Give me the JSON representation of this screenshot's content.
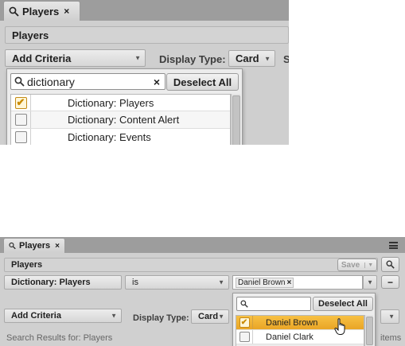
{
  "colors": {
    "accent": "#e9a526",
    "tab_strip": "#9d9d9d",
    "panel_bar": "#d3d3d3",
    "popup_bg": "#ececec"
  },
  "top": {
    "tab": {
      "icon": "search-icon",
      "label": "Players",
      "close": "×"
    },
    "panel_title": "Players",
    "add_criteria": "Add Criteria",
    "display_type_label": "Display Type:",
    "display_type_value": "Card",
    "truncated_label": "S",
    "popup": {
      "search_value": "dictionary",
      "clear": "×",
      "deselect_all": "Deselect All",
      "items": [
        {
          "label": "Dictionary: Players",
          "checked": true
        },
        {
          "label": "Dictionary: Content Alert",
          "checked": false
        },
        {
          "label": "Dictionary: Events",
          "checked": false
        }
      ]
    }
  },
  "bottom": {
    "tab": {
      "icon": "search-icon",
      "label": "Players",
      "close": "×"
    },
    "menu_icon": "hamburger-icon",
    "panel_title": "Players",
    "save_label": "Save",
    "criteria": {
      "field": "Dictionary: Players",
      "operator": "is",
      "token": "Daniel Brown",
      "token_remove": "×",
      "remove_button": "−"
    },
    "add_criteria": "Add Criteria",
    "display_type_label": "Display Type:",
    "display_type_value": "Card",
    "results_text": "Search Results for: Players",
    "items_text": "items",
    "popup": {
      "search_value": "",
      "deselect_all": "Deselect All",
      "items": [
        {
          "label": "Daniel Brown",
          "checked": true,
          "highlighted": true
        },
        {
          "label": "Daniel Clark",
          "checked": false,
          "highlighted": false
        }
      ]
    }
  }
}
